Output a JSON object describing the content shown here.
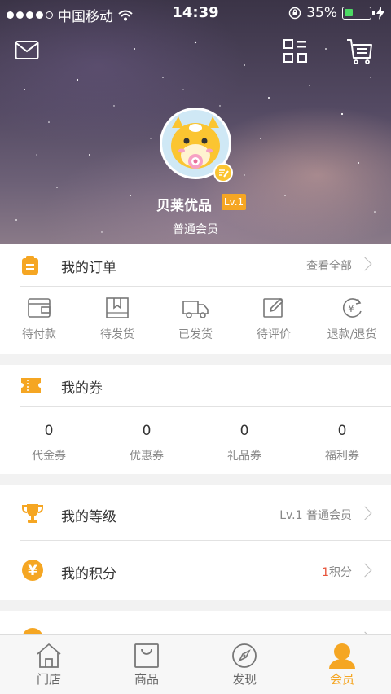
{
  "status_bar": {
    "carrier": "中国移动",
    "time": "14:39",
    "battery": "35%",
    "battery_level": 0.35
  },
  "profile": {
    "username": "贝莱优品",
    "level_badge": "Lv.1",
    "member_type": "普通会员"
  },
  "orders": {
    "title": "我的订单",
    "view_all": "查看全部",
    "items": [
      {
        "label": "待付款",
        "icon": "wallet-icon"
      },
      {
        "label": "待发货",
        "icon": "package-icon"
      },
      {
        "label": "已发货",
        "icon": "truck-icon"
      },
      {
        "label": "待评价",
        "icon": "edit-icon"
      },
      {
        "label": "退款/退货",
        "icon": "refund-icon"
      }
    ]
  },
  "coupons": {
    "title": "我的券",
    "items": [
      {
        "count": "0",
        "label": "代金券"
      },
      {
        "count": "0",
        "label": "优惠券"
      },
      {
        "count": "0",
        "label": "礼品券"
      },
      {
        "count": "0",
        "label": "福利券"
      }
    ]
  },
  "level": {
    "title": "我的等级",
    "value": "Lv.1 普通会员"
  },
  "points": {
    "title": "我的积分",
    "count": "1",
    "unit": "积分"
  },
  "tabs": [
    {
      "label": "门店",
      "icon": "store-icon",
      "active": false
    },
    {
      "label": "商品",
      "icon": "shopping-bag-icon",
      "active": false
    },
    {
      "label": "发现",
      "icon": "compass-icon",
      "active": false
    },
    {
      "label": "会员",
      "icon": "member-icon",
      "active": true
    }
  ],
  "colors": {
    "accent": "#f5a623",
    "points_number": "#e8533a"
  }
}
